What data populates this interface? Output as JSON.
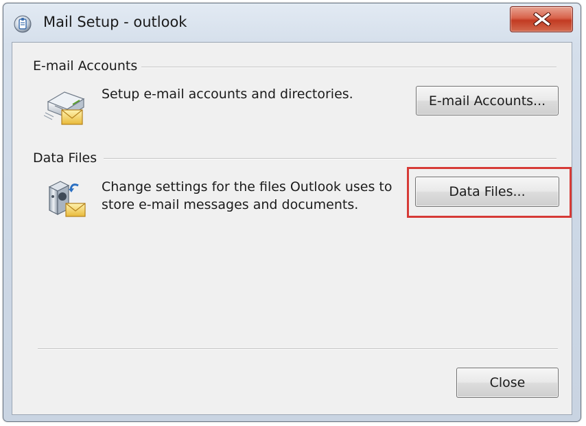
{
  "window": {
    "title": "Mail Setup - outlook",
    "icons": {
      "app": "outlook-mail-setup-icon",
      "close": "close-icon"
    },
    "colors": {
      "close_button": "#c23b22",
      "highlight": "#d63a36",
      "frame": "#d5dfeb"
    }
  },
  "email_accounts": {
    "group_label": "E-mail Accounts",
    "description": "Setup e-mail accounts and directories.",
    "button_label": "E-mail Accounts...",
    "icon": "email-accounts-icon"
  },
  "data_files": {
    "group_label": "Data Files",
    "description_line1": "Change settings for the files Outlook uses to",
    "description_line2": "store e-mail messages and documents.",
    "button_label": "Data Files...",
    "icon": "data-files-icon",
    "highlighted": true
  },
  "footer": {
    "close_label": "Close"
  }
}
